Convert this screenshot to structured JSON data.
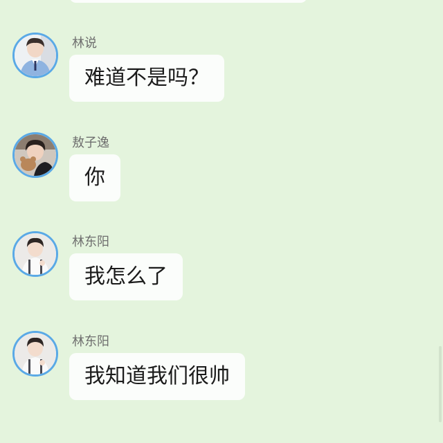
{
  "messages": [
    {
      "sender": "林说",
      "text": "难道不是吗？",
      "avatar_icon": "boy-in-blue-school-uniform-avatar"
    },
    {
      "sender": "敖子逸",
      "text": "你",
      "avatar_icon": "boy-holding-teddy-bear-avatar"
    },
    {
      "sender": "林东阳",
      "text": "我怎么了",
      "avatar_icon": "boy-in-white-shirt-suspenders-avatar"
    },
    {
      "sender": "林东阳",
      "text": "我知道我们很帅",
      "avatar_icon": "boy-in-white-shirt-suspenders-avatar"
    }
  ],
  "colors": {
    "background": "#e4f4dd",
    "bubble": "#fbfdfb",
    "avatar_ring": "#5aa9e6",
    "name_text": "#6e6e6e",
    "message_text": "#1b1b1b"
  }
}
